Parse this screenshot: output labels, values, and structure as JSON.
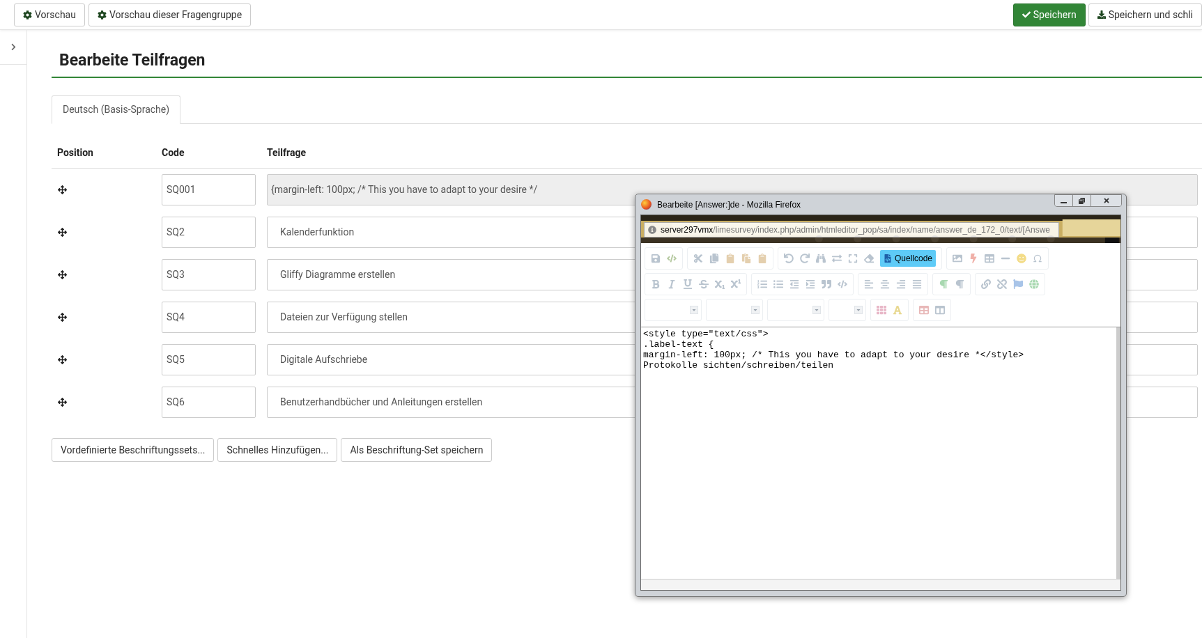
{
  "top_bar": {
    "left_buttons": [
      "Vorschau",
      "Vorschau dieser Fragengruppe"
    ],
    "right_buttons": [
      {
        "kind": "primary",
        "label": "Speichern"
      },
      {
        "kind": "default",
        "label": "Speichern und schli"
      }
    ]
  },
  "page_title": "Bearbeite Teilfragen",
  "tabs": [
    {
      "label": "Deutsch (Basis-Sprache)",
      "selected": true
    }
  ],
  "table": {
    "columns": [
      "Position",
      "Code",
      "Teilfrage"
    ],
    "rows": [
      {
        "code": "SQ001",
        "text": "{margin-left: 100px; /* This you have to adapt to your desire */",
        "disabled": true
      },
      {
        "code": "SQ2",
        "text": "Kalenderfunktion",
        "disabled": false
      },
      {
        "code": "SQ3",
        "text": "Gliffy Diagramme erstellen",
        "disabled": false
      },
      {
        "code": "SQ4",
        "text": "Dateien zur Verfügung stellen",
        "disabled": false
      },
      {
        "code": "SQ5",
        "text": "Digitale Aufschriebe",
        "disabled": false
      },
      {
        "code": "SQ6",
        "text": "Benutzerhandbücher und Anleitungen erstellen",
        "disabled": false
      }
    ]
  },
  "bottom_buttons": [
    "Vordefinierte Beschriftungssets...",
    "Schnelles Hinzufügen...",
    "Als Beschriftung-Set speichern"
  ],
  "popup": {
    "title": "Bearbeite [Answer:]de - Mozilla Firefox",
    "url_host": "server297vmx",
    "url_path": "/limesurvey/index.php/admin/htmleditor_pop/sa/index/name/answer_de_172_0/text/[Answe",
    "source_button": {
      "label": "Quellcode",
      "on": true
    },
    "editor_lines": [
      "<style type=\"text/css\">",
      ".label-text {",
      "margin-left: 100px; /* This you have to adapt to your desire *</style>",
      "Protokolle sichten/schreiben/teilen"
    ]
  }
}
